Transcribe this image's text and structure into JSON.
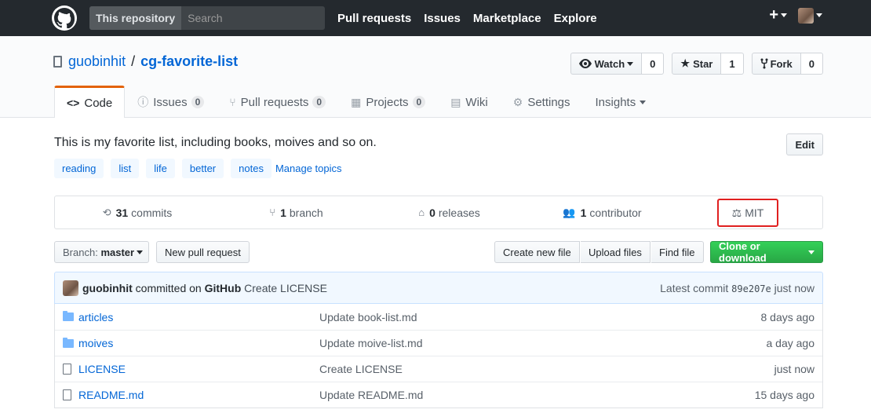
{
  "header": {
    "scope_label": "This repository",
    "search_placeholder": "Search",
    "nav": [
      "Pull requests",
      "Issues",
      "Marketplace",
      "Explore"
    ],
    "plus_label": "+"
  },
  "repo": {
    "owner": "guobinhit",
    "separator": "/",
    "name": "cg-favorite-list",
    "watch_label": "Watch",
    "watch_count": "0",
    "star_label": "Star",
    "star_count": "1",
    "fork_label": "Fork",
    "fork_count": "0"
  },
  "tabs": [
    {
      "label": "Code",
      "icon": "code-icon"
    },
    {
      "label": "Issues",
      "count": "0",
      "icon": "issue-icon"
    },
    {
      "label": "Pull requests",
      "count": "0",
      "icon": "pull-request-icon"
    },
    {
      "label": "Projects",
      "count": "0",
      "icon": "project-icon"
    },
    {
      "label": "Wiki",
      "icon": "book-icon"
    },
    {
      "label": "Settings",
      "icon": "gear-icon"
    },
    {
      "label": "Insights",
      "icon": "caret-icon"
    }
  ],
  "description": "This is my favorite list, including books, moives and so on.",
  "edit_label": "Edit",
  "topics": [
    "reading",
    "list",
    "life",
    "better",
    "notes"
  ],
  "manage_topics": "Manage topics",
  "summary": {
    "commits_count": "31",
    "commits_label": "commits",
    "branch_count": "1",
    "branch_label": "branch",
    "releases_count": "0",
    "releases_label": "releases",
    "contributor_count": "1",
    "contributor_label": "contributor",
    "license": "MIT"
  },
  "filebar": {
    "branch_prefix": "Branch:",
    "branch_name": "master",
    "new_pr": "New pull request",
    "create_file": "Create new file",
    "upload": "Upload files",
    "find": "Find file",
    "clone": "Clone or download"
  },
  "commit": {
    "author": "guobinhit",
    "committed_on": "committed on",
    "platform": "GitHub",
    "message": "Create LICENSE",
    "latest_label": "Latest commit",
    "sha": "89e207e",
    "time": "just now"
  },
  "files": [
    {
      "name": "articles",
      "type": "folder",
      "message": "Update book-list.md",
      "age": "8 days ago"
    },
    {
      "name": "moives",
      "type": "folder",
      "message": "Update moive-list.md",
      "age": "a day ago"
    },
    {
      "name": "LICENSE",
      "type": "file",
      "message": "Create LICENSE",
      "age": "just now"
    },
    {
      "name": "README.md",
      "type": "file",
      "message": "Update README.md",
      "age": "15 days ago"
    }
  ]
}
